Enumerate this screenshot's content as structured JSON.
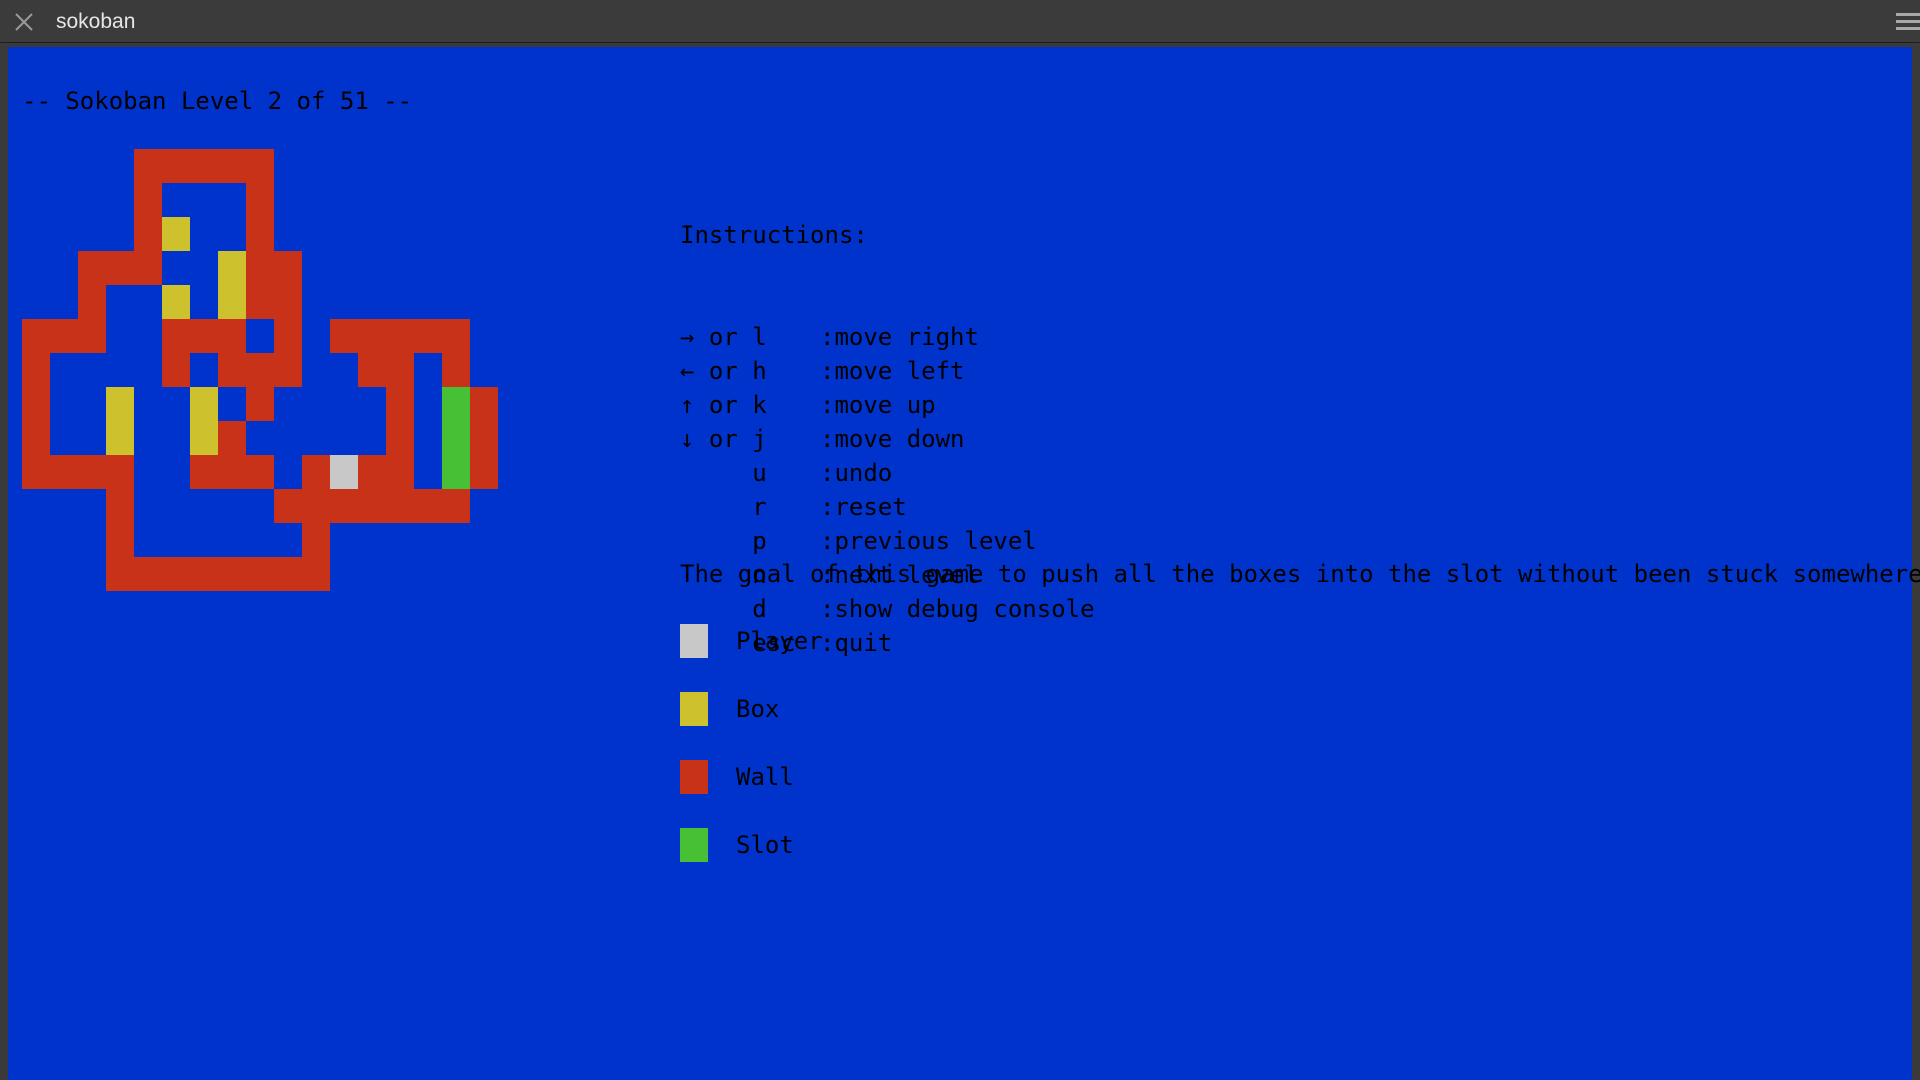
{
  "window": {
    "title": "sokoban",
    "close_icon": "close-icon",
    "menu_icon": "hamburger-menu-icon"
  },
  "game": {
    "level_heading": "-- Sokoban Level 2 of 51 --",
    "level": 2,
    "total_levels": 51,
    "board_rows": [
      "    WWWWW      ",
      "    W   W      ",
      "    WB  W      ",
      "  WWW  BWW     ",
      "  W  B BWW     ",
      "WWW  WWW W WWWWW",
      "W    W WWW  WW W",
      "W  B  B W    W SW",
      "W  B  BW     W SW",
      "WWWW  WWW WPWW SW",
      "   W     WWWWWWW",
      "   W      W     ",
      "   WWWWWWWW     "
    ],
    "colors": {
      "background": "#0033cc",
      "wall": "#c83219",
      "box": "#cdc12e",
      "slot": "#48c035",
      "player": "#c8c8c8",
      "text": "#000000"
    }
  },
  "instructions": {
    "heading": "Instructions:",
    "items": [
      {
        "key": "→ or l",
        "desc": ":move right"
      },
      {
        "key": "← or h",
        "desc": ":move left"
      },
      {
        "key": "↑ or k",
        "desc": ":move up"
      },
      {
        "key": "↓ or j",
        "desc": ":move down"
      },
      {
        "key": "     u",
        "desc": ":undo"
      },
      {
        "key": "     r",
        "desc": ":reset"
      },
      {
        "key": "     p",
        "desc": ":previous level"
      },
      {
        "key": "     n",
        "desc": ":next level"
      },
      {
        "key": "     d",
        "desc": ":show debug console"
      },
      {
        "key": "     esc",
        "desc": ":quit"
      }
    ]
  },
  "goal_text": "The goal of this game to push all the boxes into the slot without been stuck somewhere.",
  "legend": [
    {
      "label": "Player",
      "color": "#c8c8c8"
    },
    {
      "label": "Box",
      "color": "#cdc12e"
    },
    {
      "label": "Wall",
      "color": "#c83219"
    },
    {
      "label": "Slot",
      "color": "#48c035"
    }
  ]
}
